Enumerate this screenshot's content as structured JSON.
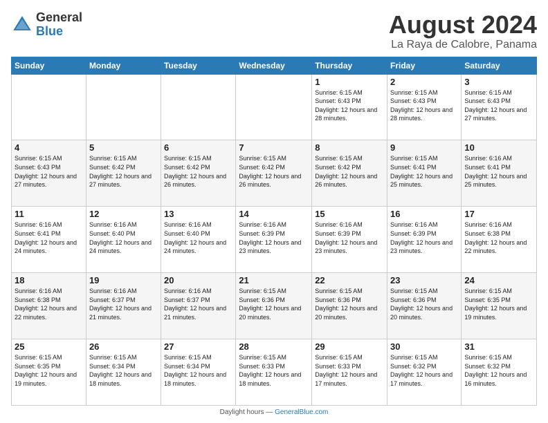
{
  "logo": {
    "general": "General",
    "blue": "Blue"
  },
  "title": "August 2024",
  "location": "La Raya de Calobre, Panama",
  "days_of_week": [
    "Sunday",
    "Monday",
    "Tuesday",
    "Wednesday",
    "Thursday",
    "Friday",
    "Saturday"
  ],
  "weeks": [
    [
      {
        "day": "",
        "info": ""
      },
      {
        "day": "",
        "info": ""
      },
      {
        "day": "",
        "info": ""
      },
      {
        "day": "",
        "info": ""
      },
      {
        "day": "1",
        "sunrise": "6:15 AM",
        "sunset": "6:43 PM",
        "daylight": "12 hours and 28 minutes."
      },
      {
        "day": "2",
        "sunrise": "6:15 AM",
        "sunset": "6:43 PM",
        "daylight": "12 hours and 28 minutes."
      },
      {
        "day": "3",
        "sunrise": "6:15 AM",
        "sunset": "6:43 PM",
        "daylight": "12 hours and 27 minutes."
      }
    ],
    [
      {
        "day": "4",
        "sunrise": "6:15 AM",
        "sunset": "6:43 PM",
        "daylight": "12 hours and 27 minutes."
      },
      {
        "day": "5",
        "sunrise": "6:15 AM",
        "sunset": "6:42 PM",
        "daylight": "12 hours and 27 minutes."
      },
      {
        "day": "6",
        "sunrise": "6:15 AM",
        "sunset": "6:42 PM",
        "daylight": "12 hours and 26 minutes."
      },
      {
        "day": "7",
        "sunrise": "6:15 AM",
        "sunset": "6:42 PM",
        "daylight": "12 hours and 26 minutes."
      },
      {
        "day": "8",
        "sunrise": "6:15 AM",
        "sunset": "6:42 PM",
        "daylight": "12 hours and 26 minutes."
      },
      {
        "day": "9",
        "sunrise": "6:15 AM",
        "sunset": "6:41 PM",
        "daylight": "12 hours and 25 minutes."
      },
      {
        "day": "10",
        "sunrise": "6:16 AM",
        "sunset": "6:41 PM",
        "daylight": "12 hours and 25 minutes."
      }
    ],
    [
      {
        "day": "11",
        "sunrise": "6:16 AM",
        "sunset": "6:41 PM",
        "daylight": "12 hours and 24 minutes."
      },
      {
        "day": "12",
        "sunrise": "6:16 AM",
        "sunset": "6:40 PM",
        "daylight": "12 hours and 24 minutes."
      },
      {
        "day": "13",
        "sunrise": "6:16 AM",
        "sunset": "6:40 PM",
        "daylight": "12 hours and 24 minutes."
      },
      {
        "day": "14",
        "sunrise": "6:16 AM",
        "sunset": "6:39 PM",
        "daylight": "12 hours and 23 minutes."
      },
      {
        "day": "15",
        "sunrise": "6:16 AM",
        "sunset": "6:39 PM",
        "daylight": "12 hours and 23 minutes."
      },
      {
        "day": "16",
        "sunrise": "6:16 AM",
        "sunset": "6:39 PM",
        "daylight": "12 hours and 23 minutes."
      },
      {
        "day": "17",
        "sunrise": "6:16 AM",
        "sunset": "6:38 PM",
        "daylight": "12 hours and 22 minutes."
      }
    ],
    [
      {
        "day": "18",
        "sunrise": "6:16 AM",
        "sunset": "6:38 PM",
        "daylight": "12 hours and 22 minutes."
      },
      {
        "day": "19",
        "sunrise": "6:16 AM",
        "sunset": "6:37 PM",
        "daylight": "12 hours and 21 minutes."
      },
      {
        "day": "20",
        "sunrise": "6:16 AM",
        "sunset": "6:37 PM",
        "daylight": "12 hours and 21 minutes."
      },
      {
        "day": "21",
        "sunrise": "6:15 AM",
        "sunset": "6:36 PM",
        "daylight": "12 hours and 20 minutes."
      },
      {
        "day": "22",
        "sunrise": "6:15 AM",
        "sunset": "6:36 PM",
        "daylight": "12 hours and 20 minutes."
      },
      {
        "day": "23",
        "sunrise": "6:15 AM",
        "sunset": "6:36 PM",
        "daylight": "12 hours and 20 minutes."
      },
      {
        "day": "24",
        "sunrise": "6:15 AM",
        "sunset": "6:35 PM",
        "daylight": "12 hours and 19 minutes."
      }
    ],
    [
      {
        "day": "25",
        "sunrise": "6:15 AM",
        "sunset": "6:35 PM",
        "daylight": "12 hours and 19 minutes."
      },
      {
        "day": "26",
        "sunrise": "6:15 AM",
        "sunset": "6:34 PM",
        "daylight": "12 hours and 18 minutes."
      },
      {
        "day": "27",
        "sunrise": "6:15 AM",
        "sunset": "6:34 PM",
        "daylight": "12 hours and 18 minutes."
      },
      {
        "day": "28",
        "sunrise": "6:15 AM",
        "sunset": "6:33 PM",
        "daylight": "12 hours and 18 minutes."
      },
      {
        "day": "29",
        "sunrise": "6:15 AM",
        "sunset": "6:33 PM",
        "daylight": "12 hours and 17 minutes."
      },
      {
        "day": "30",
        "sunrise": "6:15 AM",
        "sunset": "6:32 PM",
        "daylight": "12 hours and 17 minutes."
      },
      {
        "day": "31",
        "sunrise": "6:15 AM",
        "sunset": "6:32 PM",
        "daylight": "12 hours and 16 minutes."
      }
    ]
  ],
  "footer": "Daylight hours"
}
